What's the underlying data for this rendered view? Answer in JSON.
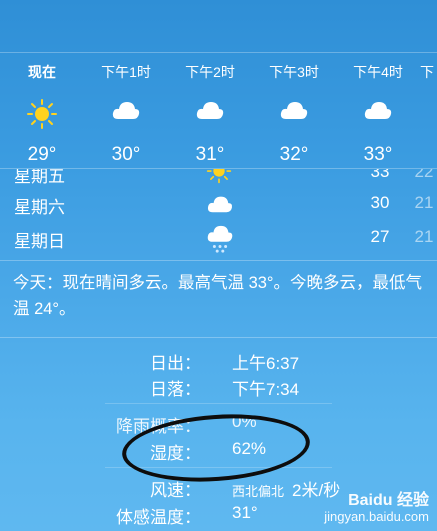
{
  "hourly": [
    {
      "label": "现在",
      "icon": "sun-icon",
      "temp": "29°"
    },
    {
      "label": "下午1时",
      "icon": "cloud-icon",
      "temp": "30°"
    },
    {
      "label": "下午2时",
      "icon": "cloud-icon",
      "temp": "31°"
    },
    {
      "label": "下午3时",
      "icon": "cloud-icon",
      "temp": "32°"
    },
    {
      "label": "下午4时",
      "icon": "cloud-icon",
      "temp": "33°"
    },
    {
      "label": "下",
      "icon": "cloud-icon",
      "temp": ""
    }
  ],
  "daily": [
    {
      "day": "星期五",
      "icon": "sun-icon",
      "hi": "33",
      "lo": "22"
    },
    {
      "day": "星期六",
      "icon": "cloud-icon",
      "hi": "30",
      "lo": "21"
    },
    {
      "day": "星期日",
      "icon": "rain-cloud-icon",
      "hi": "27",
      "lo": "21"
    }
  ],
  "summary": "今天：现在晴间多云。最高气温 33°。今晚多云，最低气温 24°。",
  "details": {
    "sunrise_label": "日出：",
    "sunrise_value": "上午6:37",
    "sunset_label": "日落：",
    "sunset_value": "下午7:34",
    "rain_label": "降雨概率：",
    "rain_value": "0%",
    "humidity_label": "湿度：",
    "humidity_value": "62%",
    "wind_label": "风速：",
    "wind_dir": "西北偏北",
    "wind_value": "2米/秒",
    "feels_label": "体感温度：",
    "feels_value": "31°"
  },
  "watermark": {
    "brand": "Baidu 经验",
    "url": "jingyan.baidu.com"
  },
  "colors": {
    "sun": "#ffd21f",
    "annotation": "#0d0d0d"
  }
}
